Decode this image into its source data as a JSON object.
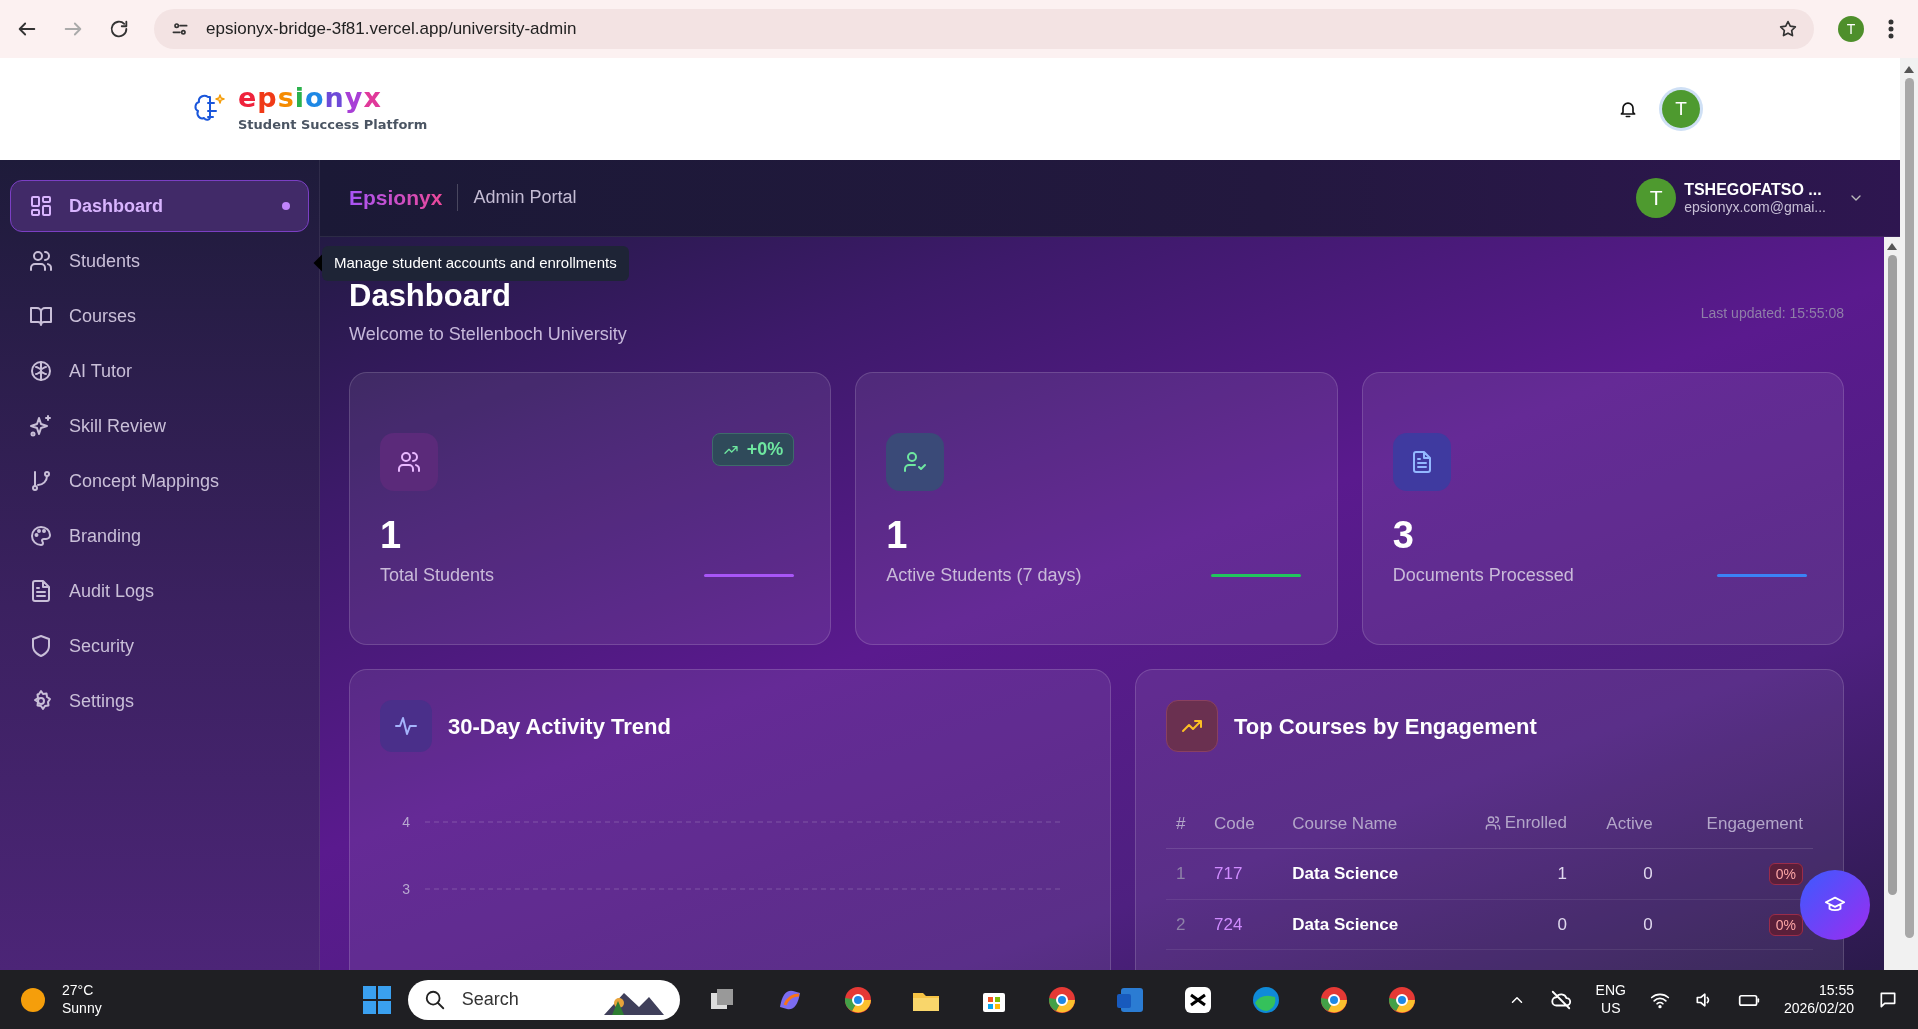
{
  "browser": {
    "url": "epsionyx-bridge-3f81.vercel.app/university-admin",
    "profile_initial": "T"
  },
  "header": {
    "logo_text": "epsionyx",
    "tagline": "Student Success Platform",
    "avatar_initial": "T"
  },
  "sidebar": {
    "items": [
      {
        "label": "Dashboard",
        "selected": true
      },
      {
        "label": "Students",
        "selected": false
      },
      {
        "label": "Courses",
        "selected": false
      },
      {
        "label": "AI Tutor",
        "selected": false
      },
      {
        "label": "Skill Review",
        "selected": false
      },
      {
        "label": "Concept Mappings",
        "selected": false
      },
      {
        "label": "Branding",
        "selected": false
      },
      {
        "label": "Audit Logs",
        "selected": false
      },
      {
        "label": "Security",
        "selected": false
      },
      {
        "label": "Settings",
        "selected": false
      }
    ]
  },
  "topbar": {
    "brand": "Epsionyx",
    "portal": "Admin Portal",
    "user_initial": "T",
    "user_name": "TSHEGOFATSO ...",
    "user_email": "epsionyx.com@gmai..."
  },
  "tooltip": "Manage student accounts and enrollments",
  "page": {
    "title": "Dashboard",
    "subtitle": "Welcome to Stellenboch University",
    "last_updated": "Last updated: 15:55:08"
  },
  "stats": [
    {
      "value": "1",
      "label": "Total Students",
      "trend": "+0%",
      "color": "#a855f7"
    },
    {
      "value": "1",
      "label": "Active Students (7 days)",
      "color": "#22c55e"
    },
    {
      "value": "3",
      "label": "Documents Processed",
      "color": "#3b82f6"
    }
  ],
  "activity": {
    "title": "30-Day Activity Trend",
    "axis_labels": [
      "4",
      "3"
    ]
  },
  "top_courses": {
    "title": "Top Courses by Engagement",
    "columns": [
      "#",
      "Code",
      "Course Name",
      "Enrolled",
      "Active",
      "Engagement"
    ],
    "rows": [
      [
        "1",
        "717",
        "Data Science",
        "1",
        "0",
        "0%"
      ],
      [
        "2",
        "724",
        "Data Science",
        "0",
        "0",
        "0%"
      ]
    ]
  },
  "taskbar": {
    "temperature": "27°C",
    "weather": "Sunny",
    "search_placeholder": "Search",
    "language": "ENG",
    "region": "US",
    "time": "15:55",
    "date": "2026/02/20"
  }
}
